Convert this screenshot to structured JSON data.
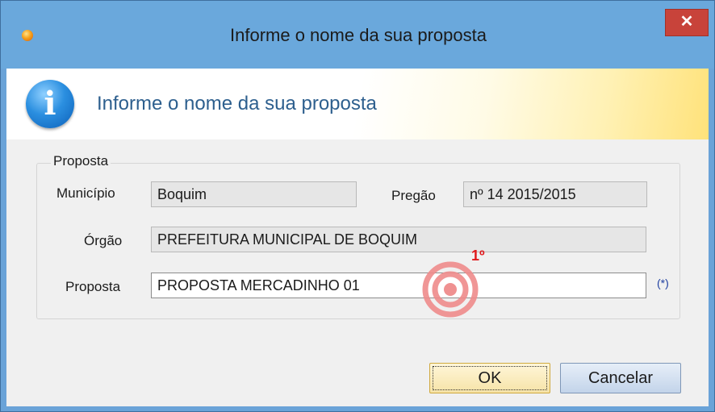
{
  "window": {
    "title": "Informe o nome da sua proposta",
    "close_label": "✕"
  },
  "header": {
    "text": "Informe o nome da sua proposta",
    "icon": "info-icon"
  },
  "group": {
    "legend": "Proposta"
  },
  "fields": {
    "municipio": {
      "label": "Município",
      "value": "Boquim"
    },
    "pregao": {
      "label": "Pregão",
      "value": "nº 14 2015/2015"
    },
    "orgao": {
      "label": "Órgão",
      "value": "PREFEITURA MUNICIPAL DE BOQUIM"
    },
    "proposta": {
      "label": "Proposta",
      "value": "PROPOSTA MERCADINHO 01",
      "required_mark": "(*)"
    }
  },
  "annotation": {
    "step_label": "1º",
    "color": "#e0181b"
  },
  "buttons": {
    "ok": "OK",
    "cancel": "Cancelar"
  }
}
